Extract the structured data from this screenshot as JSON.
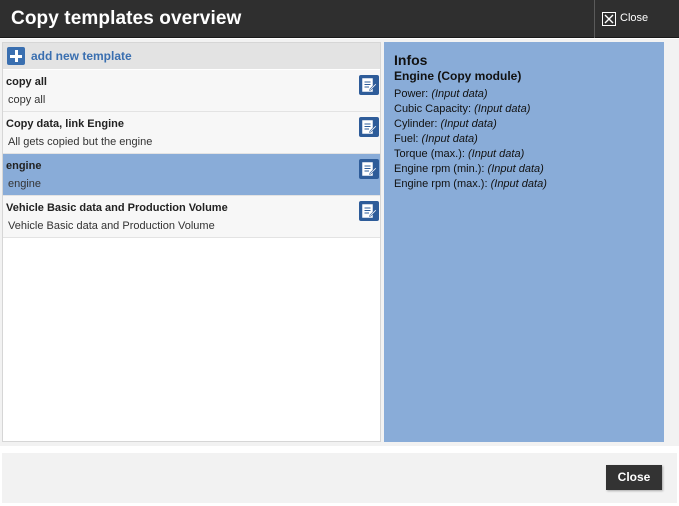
{
  "dialog": {
    "title": "Copy templates overview",
    "close_label": "Close"
  },
  "left": {
    "add_label": "add new template",
    "templates": [
      {
        "name": "copy all",
        "description": "copy all",
        "selected": false
      },
      {
        "name": "Copy data, link Engine",
        "description": "All gets copied but the engine",
        "selected": false
      },
      {
        "name": "engine",
        "description": "engine",
        "selected": true
      },
      {
        "name": "Vehicle Basic data and Production Volume",
        "description": "Vehicle Basic data and Production Volume",
        "selected": false
      }
    ]
  },
  "infos": {
    "heading": "Infos",
    "subheading": "Engine (Copy module)",
    "lines": [
      {
        "label": "Power:",
        "value": "(Input data)"
      },
      {
        "label": "Cubic Capacity:",
        "value": "(Input data)"
      },
      {
        "label": "Cylinder:",
        "value": "(Input data)"
      },
      {
        "label": "Fuel:",
        "value": "(Input data)"
      },
      {
        "label": "Torque (max.):",
        "value": "(Input data)"
      },
      {
        "label": "Engine rpm (min.):",
        "value": "(Input data)"
      },
      {
        "label": "Engine rpm (max.):",
        "value": "(Input data)"
      }
    ]
  },
  "footer": {
    "close_button_label": "Close"
  },
  "colors": {
    "title_bar": "#2f2f2f",
    "accent_blue": "#3a6fb0",
    "selected_row": "#89acd8",
    "info_panel": "#89acd8"
  },
  "icons": {
    "close": "close-x-icon",
    "add": "plus-icon",
    "edit": "edit-template-icon"
  }
}
